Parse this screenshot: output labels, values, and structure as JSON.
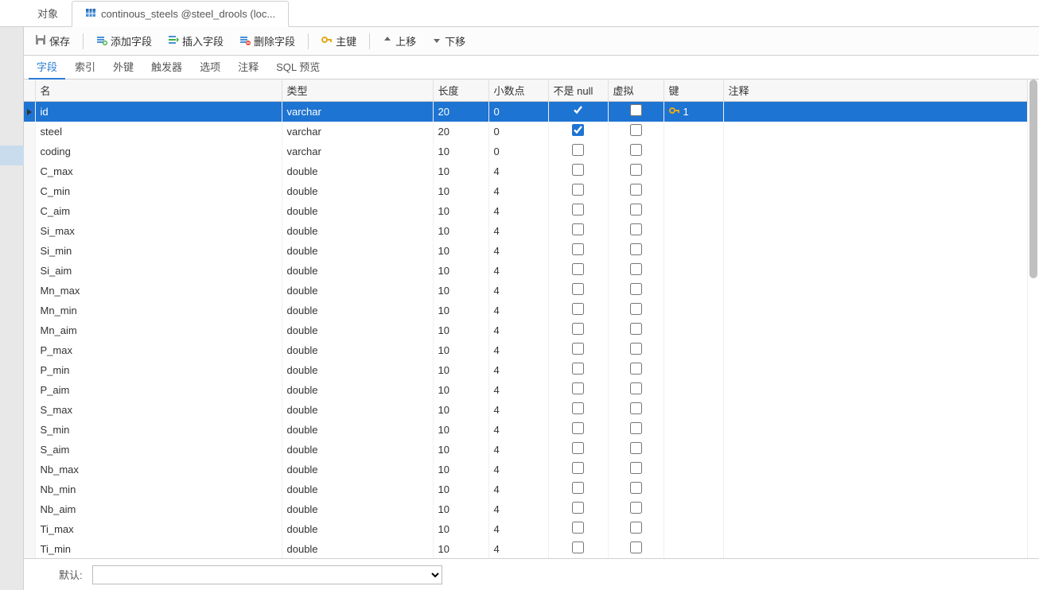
{
  "tabs": {
    "object": "对象",
    "active": "continous_steels @steel_drools (loc..."
  },
  "toolbar": {
    "save": "保存",
    "addfield": "添加字段",
    "insertfield": "插入字段",
    "deletefield": "删除字段",
    "primarykey": "主键",
    "moveup": "上移",
    "movedown": "下移"
  },
  "subtabs": {
    "fields": "字段",
    "indexes": "索引",
    "fk": "外键",
    "triggers": "触发器",
    "options": "选项",
    "comment": "注释",
    "sqlpreview": "SQL 预览"
  },
  "headers": {
    "name": "名",
    "type": "类型",
    "length": "长度",
    "decimals": "小数点",
    "notnull": "不是 null",
    "virtual": "虚拟",
    "key": "键",
    "comment": "注释"
  },
  "footer": {
    "default": "默认:"
  },
  "keytag": "1",
  "rows": [
    {
      "name": "id",
      "type": "varchar",
      "len": "20",
      "dec": "0",
      "nn": true,
      "virt": false,
      "key": true,
      "sel": true
    },
    {
      "name": "steel",
      "type": "varchar",
      "len": "20",
      "dec": "0",
      "nn": true,
      "virt": false,
      "key": false,
      "sel": false
    },
    {
      "name": "coding",
      "type": "varchar",
      "len": "10",
      "dec": "0",
      "nn": false,
      "virt": false,
      "key": false,
      "sel": false
    },
    {
      "name": "C_max",
      "type": "double",
      "len": "10",
      "dec": "4",
      "nn": false,
      "virt": false,
      "key": false,
      "sel": false
    },
    {
      "name": "C_min",
      "type": "double",
      "len": "10",
      "dec": "4",
      "nn": false,
      "virt": false,
      "key": false,
      "sel": false
    },
    {
      "name": "C_aim",
      "type": "double",
      "len": "10",
      "dec": "4",
      "nn": false,
      "virt": false,
      "key": false,
      "sel": false
    },
    {
      "name": "Si_max",
      "type": "double",
      "len": "10",
      "dec": "4",
      "nn": false,
      "virt": false,
      "key": false,
      "sel": false
    },
    {
      "name": "Si_min",
      "type": "double",
      "len": "10",
      "dec": "4",
      "nn": false,
      "virt": false,
      "key": false,
      "sel": false
    },
    {
      "name": "Si_aim",
      "type": "double",
      "len": "10",
      "dec": "4",
      "nn": false,
      "virt": false,
      "key": false,
      "sel": false
    },
    {
      "name": "Mn_max",
      "type": "double",
      "len": "10",
      "dec": "4",
      "nn": false,
      "virt": false,
      "key": false,
      "sel": false
    },
    {
      "name": "Mn_min",
      "type": "double",
      "len": "10",
      "dec": "4",
      "nn": false,
      "virt": false,
      "key": false,
      "sel": false
    },
    {
      "name": "Mn_aim",
      "type": "double",
      "len": "10",
      "dec": "4",
      "nn": false,
      "virt": false,
      "key": false,
      "sel": false
    },
    {
      "name": "P_max",
      "type": "double",
      "len": "10",
      "dec": "4",
      "nn": false,
      "virt": false,
      "key": false,
      "sel": false
    },
    {
      "name": "P_min",
      "type": "double",
      "len": "10",
      "dec": "4",
      "nn": false,
      "virt": false,
      "key": false,
      "sel": false
    },
    {
      "name": "P_aim",
      "type": "double",
      "len": "10",
      "dec": "4",
      "nn": false,
      "virt": false,
      "key": false,
      "sel": false
    },
    {
      "name": "S_max",
      "type": "double",
      "len": "10",
      "dec": "4",
      "nn": false,
      "virt": false,
      "key": false,
      "sel": false
    },
    {
      "name": "S_min",
      "type": "double",
      "len": "10",
      "dec": "4",
      "nn": false,
      "virt": false,
      "key": false,
      "sel": false
    },
    {
      "name": "S_aim",
      "type": "double",
      "len": "10",
      "dec": "4",
      "nn": false,
      "virt": false,
      "key": false,
      "sel": false
    },
    {
      "name": "Nb_max",
      "type": "double",
      "len": "10",
      "dec": "4",
      "nn": false,
      "virt": false,
      "key": false,
      "sel": false
    },
    {
      "name": "Nb_min",
      "type": "double",
      "len": "10",
      "dec": "4",
      "nn": false,
      "virt": false,
      "key": false,
      "sel": false
    },
    {
      "name": "Nb_aim",
      "type": "double",
      "len": "10",
      "dec": "4",
      "nn": false,
      "virt": false,
      "key": false,
      "sel": false
    },
    {
      "name": "Ti_max",
      "type": "double",
      "len": "10",
      "dec": "4",
      "nn": false,
      "virt": false,
      "key": false,
      "sel": false
    },
    {
      "name": "Ti_min",
      "type": "double",
      "len": "10",
      "dec": "4",
      "nn": false,
      "virt": false,
      "key": false,
      "sel": false
    }
  ]
}
